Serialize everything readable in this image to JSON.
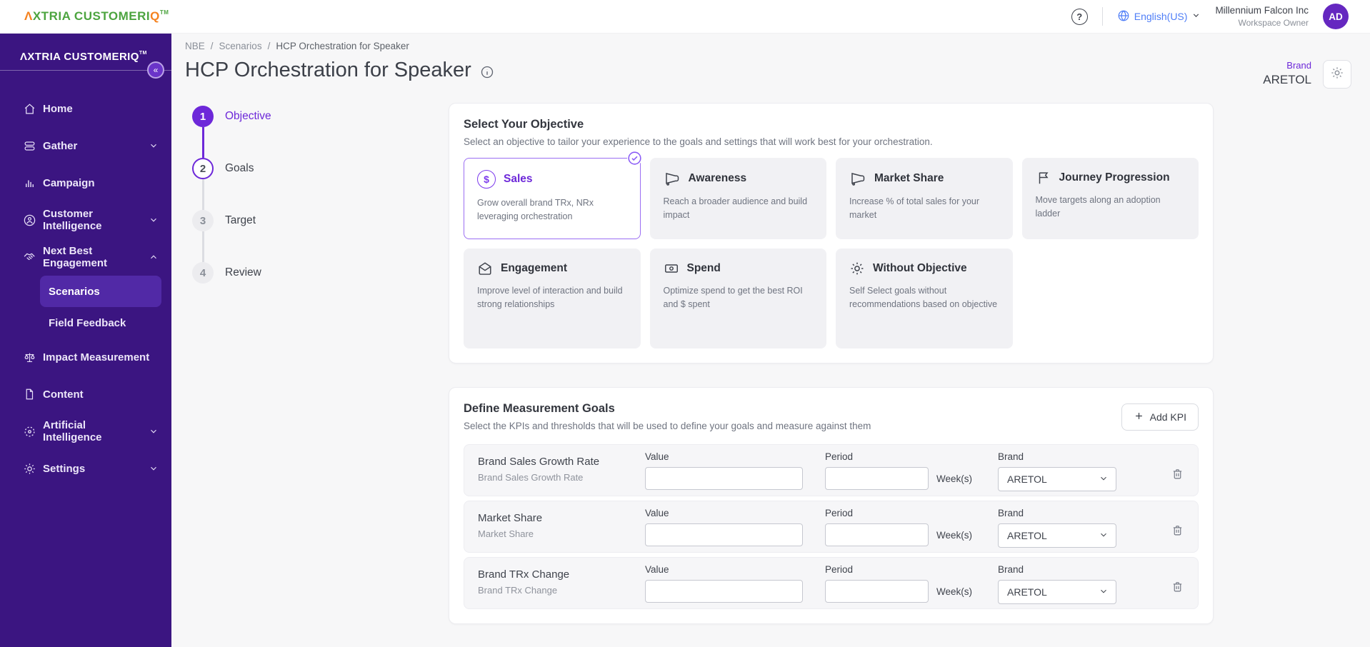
{
  "colors": {
    "sidebar_purple": "#3b1581",
    "active_item_purple": "#5129a6",
    "accent_purple": "#6d28d9",
    "selected_card_border": "#9b6ef3",
    "language_blue": "#4f7ef7",
    "logo_green": "#4ca43f",
    "logo_orange": "#f5821f"
  },
  "topbar": {
    "logo_a": "Λ",
    "logo_main": "XTRIA CUSTOMERI",
    "logo_accent": "Q",
    "logo_tm": "TM",
    "language": "English(US)",
    "company": "Millennium Falcon Inc",
    "role": "Workspace Owner",
    "avatar_initials": "AD"
  },
  "sidebar": {
    "logo_a": "Λ",
    "logo_main": "XTRIA CUSTOMERI",
    "logo_accent": "Q",
    "logo_tm": "TM",
    "collapse_glyph": "«",
    "items": [
      {
        "label": "Home"
      },
      {
        "label": "Gather"
      },
      {
        "label": "Campaign"
      },
      {
        "label": "Customer Intelligence"
      },
      {
        "label": "Next Best Engagement"
      },
      {
        "label": "Scenarios"
      },
      {
        "label": "Field Feedback"
      },
      {
        "label": "Impact Measurement"
      },
      {
        "label": "Content"
      },
      {
        "label": "Artificial Intelligence"
      },
      {
        "label": "Settings"
      }
    ]
  },
  "breadcrumb": {
    "separator": "/",
    "items": [
      "NBE",
      "Scenarios",
      "HCP Orchestration for Speaker"
    ]
  },
  "page": {
    "title": "HCP Orchestration for Speaker",
    "brand_label": "Brand",
    "brand_value": "ARETOL"
  },
  "stepper": {
    "steps": [
      {
        "num": "1",
        "label": "Objective"
      },
      {
        "num": "2",
        "label": "Goals"
      },
      {
        "num": "3",
        "label": "Target"
      },
      {
        "num": "4",
        "label": "Review"
      }
    ]
  },
  "objective_section": {
    "title": "Select Your Objective",
    "subtitle": "Select an objective to tailor your experience to the goals and settings that will work best for your orchestration.",
    "cards": [
      {
        "name": "Sales",
        "description": "Grow overall brand TRx, NRx leveraging orchestration",
        "icon": "dollar-circle",
        "selected": true
      },
      {
        "name": "Awareness",
        "description": "Reach a broader audience and build impact",
        "icon": "megaphone",
        "selected": false
      },
      {
        "name": "Market Share",
        "description": "Increase % of total sales for your market",
        "icon": "megaphone",
        "selected": false
      },
      {
        "name": "Journey Progression",
        "description": "Move targets along an adoption ladder",
        "icon": "flag",
        "selected": false
      },
      {
        "name": "Engagement",
        "description": "Improve level of interaction and build strong relationships",
        "icon": "mail-open",
        "selected": false
      },
      {
        "name": "Spend",
        "description": "Optimize spend to get the best ROI and $ spent",
        "icon": "banknote",
        "selected": false
      },
      {
        "name": "Without Objective",
        "description": "Self Select goals without recommendations based on objective",
        "icon": "gear",
        "selected": false
      }
    ]
  },
  "goals_section": {
    "title": "Define Measurement Goals",
    "subtitle": "Select the KPIs and thresholds that will be used to define your goals and measure against them",
    "add_button": "Add KPI",
    "value_label": "Value",
    "period_label": "Period",
    "period_suffix": "Week(s)",
    "brand_label": "Brand",
    "rows": [
      {
        "name": "Brand Sales Growth Rate",
        "subtitle": "Brand Sales Growth Rate",
        "value": "",
        "period": "",
        "brand": "ARETOL"
      },
      {
        "name": "Market Share",
        "subtitle": "Market Share",
        "value": "",
        "period": "",
        "brand": "ARETOL"
      },
      {
        "name": "Brand TRx Change",
        "subtitle": "Brand TRx Change",
        "value": "",
        "period": "",
        "brand": "ARETOL"
      }
    ]
  }
}
